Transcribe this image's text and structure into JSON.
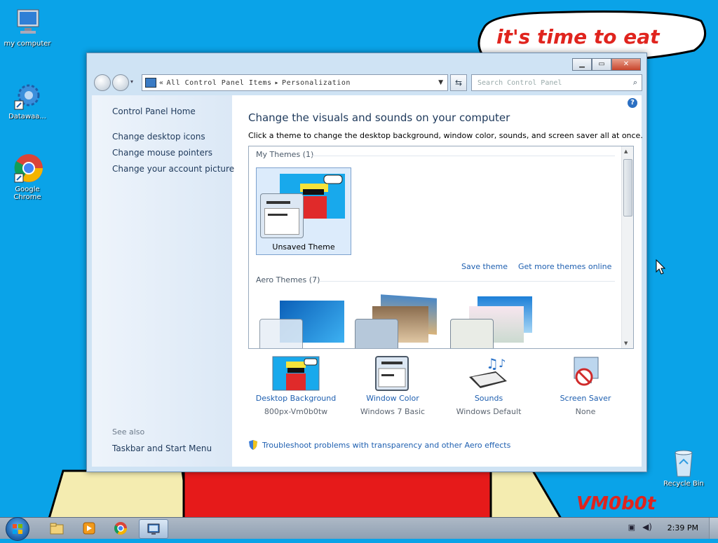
{
  "desktop": {
    "icons": [
      {
        "label": "my computer"
      },
      {
        "label": "Datawaa..."
      },
      {
        "label": "Google Chrome"
      },
      {
        "label": "Recycle Bin"
      }
    ],
    "speech_bubble_text": "it's time to eat",
    "watermark": "VM0b0t"
  },
  "window": {
    "title_buttons": {
      "minimize": "▁",
      "maximize": "▭",
      "close": "✕"
    },
    "breadcrumb": {
      "prefix": "«",
      "item1": "All Control Panel Items",
      "sep": "▸",
      "item2": "Personalization"
    },
    "search_placeholder": "Search Control Panel",
    "sidebar": {
      "home": "Control Panel Home",
      "links": [
        "Change desktop icons",
        "Change mouse pointers",
        "Change your account picture"
      ],
      "see_also": "See also",
      "see_also_link": "Taskbar and Start Menu"
    },
    "main": {
      "heading": "Change the visuals and sounds on your computer",
      "subheading": "Click a theme to change the desktop background, window color, sounds, and screen saver all at once.",
      "my_themes_header": "My Themes (1)",
      "unsaved_theme_label": "Unsaved Theme",
      "save_theme": "Save theme",
      "get_more_themes": "Get more themes online",
      "aero_themes_header": "Aero Themes (7)",
      "bottom_items": [
        {
          "title": "Desktop Background",
          "value": "800px-Vm0b0tw"
        },
        {
          "title": "Window Color",
          "value": "Windows 7 Basic"
        },
        {
          "title": "Sounds",
          "value": "Windows Default"
        },
        {
          "title": "Screen Saver",
          "value": "None"
        }
      ],
      "troubleshoot": "Troubleshoot problems with transparency and other Aero effects"
    }
  },
  "taskbar": {
    "clock": "2:39 PM"
  },
  "colors": {
    "desktop": "#0aa3e8",
    "link": "#1e5fb0",
    "heading": "#1e395b"
  }
}
